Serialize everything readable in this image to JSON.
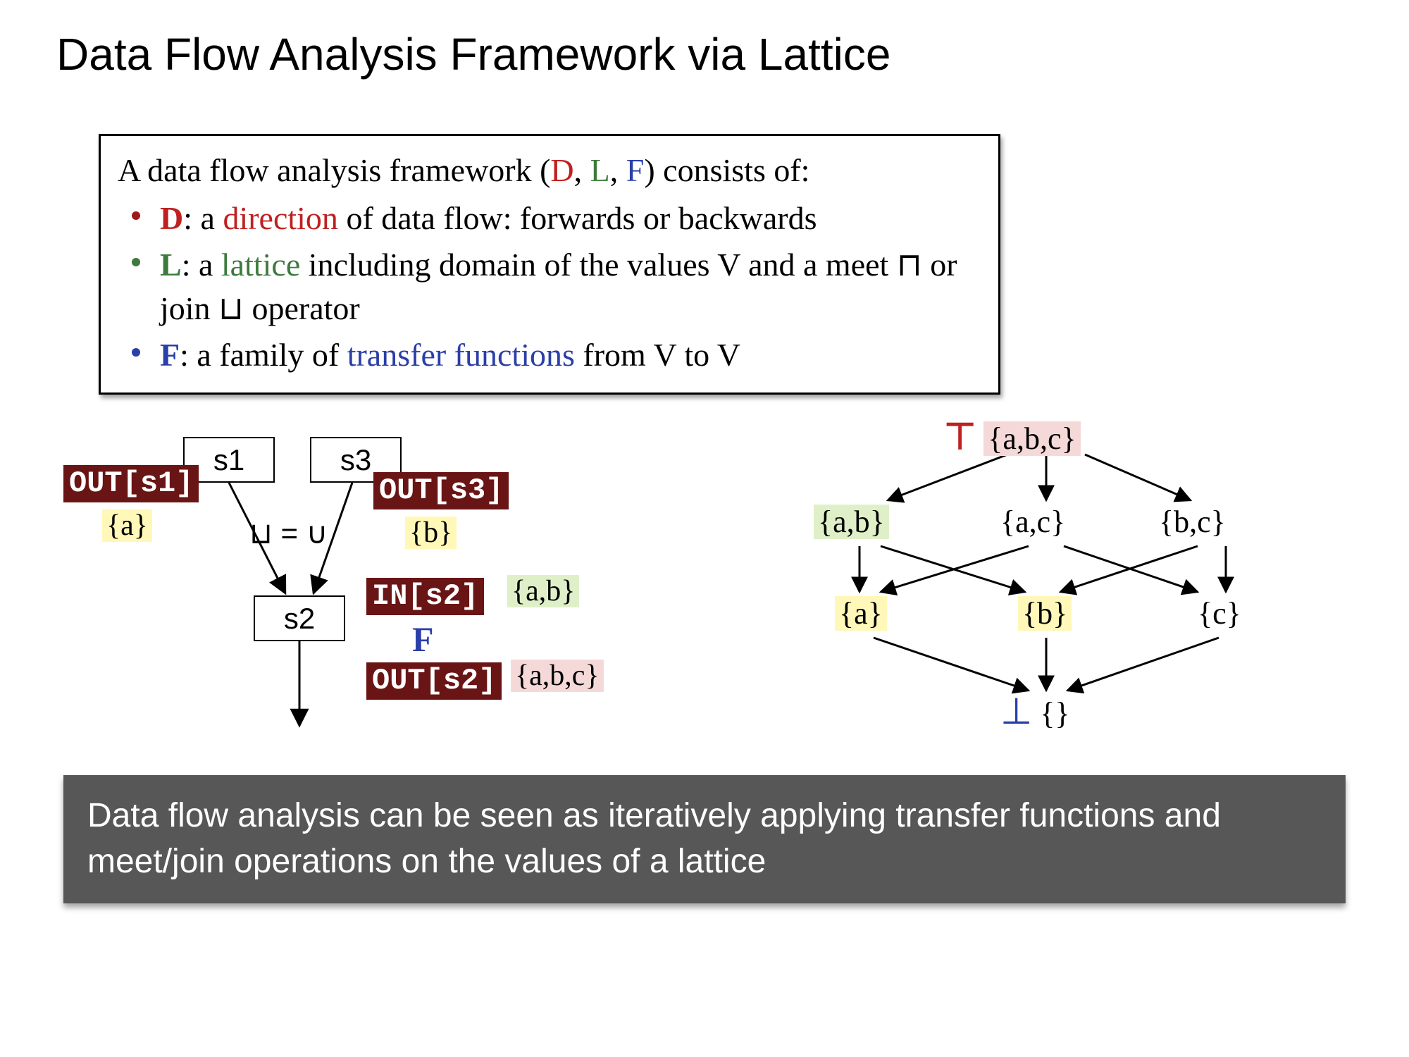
{
  "title": "Data Flow Analysis Framework via Lattice",
  "def": {
    "intro_pre": "A data flow analysis framework (",
    "D": "D",
    "comma1": ", ",
    "L": "L",
    "comma2": ", ",
    "F": "F",
    "intro_post": ") consists of:",
    "d_item_pre": "D",
    "d_item_mid": ": a ",
    "d_item_kw": "direction",
    "d_item_post": " of data flow: forwards or backwards",
    "l_item_pre": "L",
    "l_item_mid": ": a ",
    "l_item_kw": "lattice",
    "l_item_post": " including domain of the values V and a meet ⊓ or join ⊔ operator",
    "f_item_pre": "F",
    "f_item_mid": ": a family of ",
    "f_item_kw": "transfer functions",
    "f_item_post": " from V to V"
  },
  "flow": {
    "s1": "s1",
    "s2": "s2",
    "s3": "s3",
    "out_s1": "OUT[s1]",
    "out_s3": "OUT[s3]",
    "in_s2": "IN[s2]",
    "out_s2": "OUT[s2]",
    "set_a": "{a}",
    "set_b": "{b}",
    "set_ab": "{a,b}",
    "set_abc": "{a,b,c}",
    "join_eq": "⊔ = ∪",
    "F_label": "F"
  },
  "lattice": {
    "top_sym": "⊤",
    "top_set": "{a,b,c}",
    "ab": "{a,b}",
    "ac": "{a,c}",
    "bc": "{b,c}",
    "a": "{a}",
    "b": "{b}",
    "c": "{c}",
    "bot_sym": "⊥",
    "bot_set": "{}"
  },
  "footer": "Data flow analysis can be seen as iteratively applying transfer functions and meet/join operations on the values of a lattice"
}
